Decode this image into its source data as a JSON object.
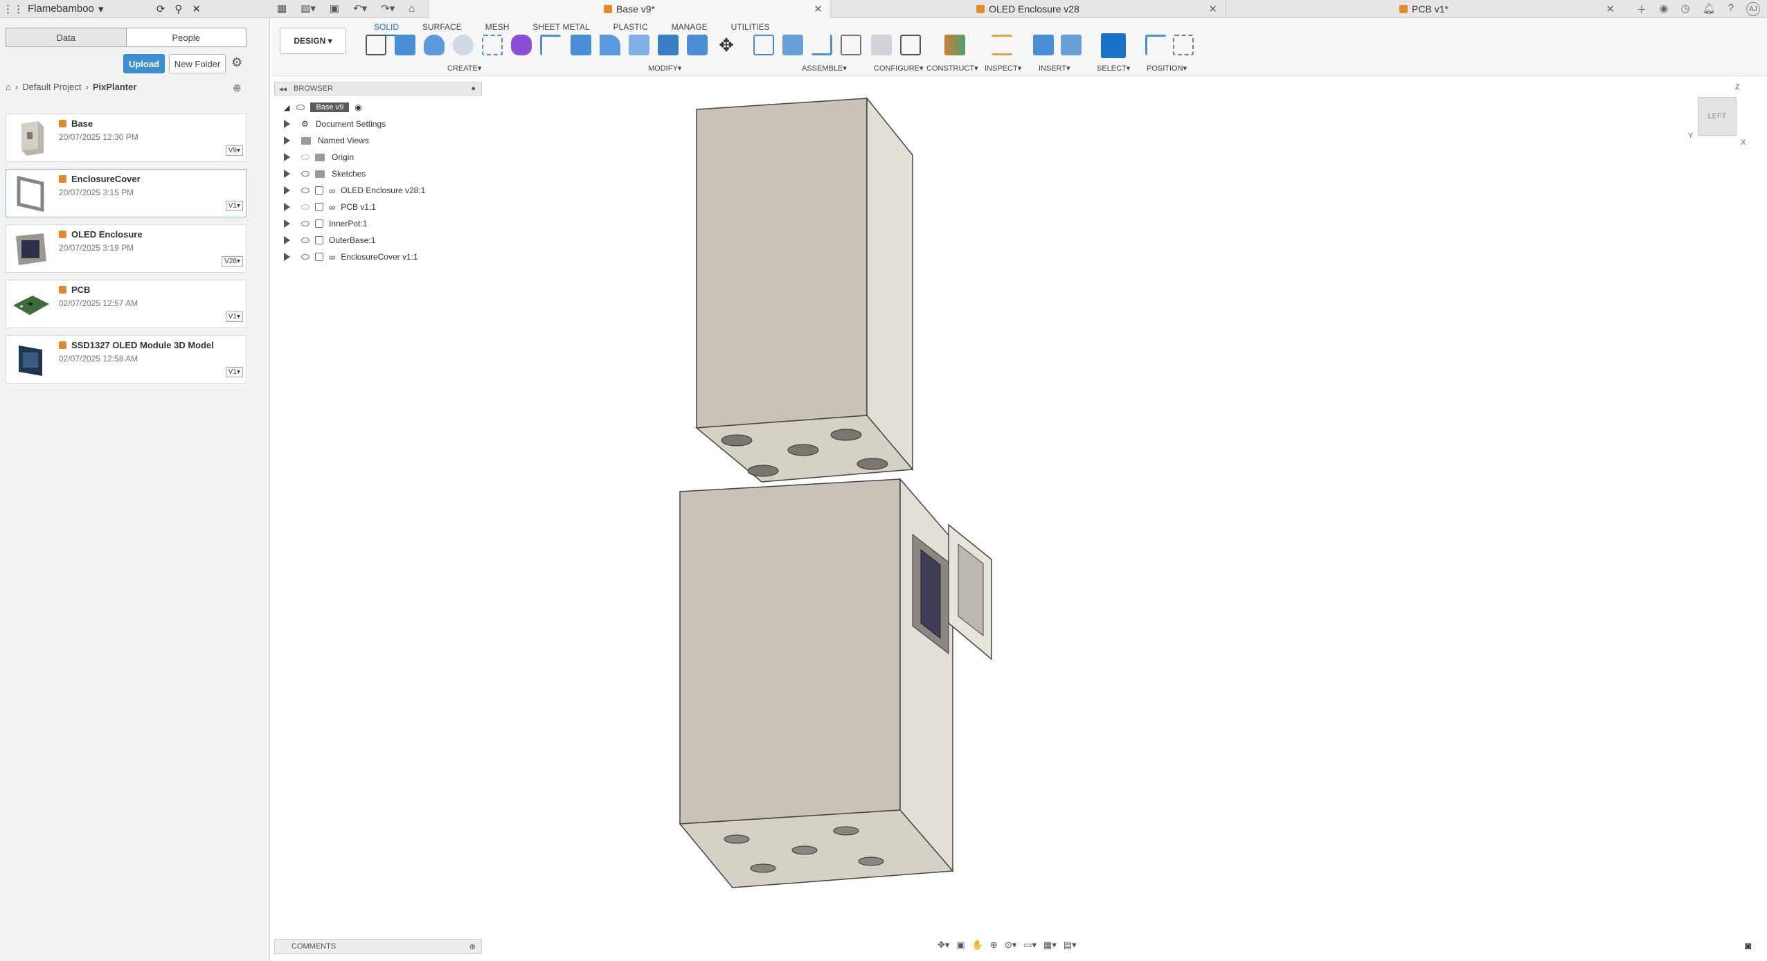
{
  "top_bar": {
    "team_name": "Flamebamboo",
    "tabs": [
      {
        "label": "Base v9*"
      },
      {
        "label": "OLED Enclosure v28"
      },
      {
        "label": "PCB v1*"
      }
    ],
    "user_initials": "AJ"
  },
  "data_panel": {
    "tab_data": "Data",
    "tab_people": "People",
    "upload_label": "Upload",
    "new_folder_label": "New Folder",
    "breadcrumb": [
      "Default Project",
      "PixPlanter"
    ],
    "files": [
      {
        "name": "Base",
        "date": "20/07/2025 12:30 PM",
        "version": "V9"
      },
      {
        "name": "EnclosureCover",
        "date": "20/07/2025 3:15 PM",
        "version": "V1"
      },
      {
        "name": "OLED Enclosure",
        "date": "20/07/2025 3:19 PM",
        "version": "V28"
      },
      {
        "name": "PCB",
        "date": "02/07/2025 12:57 AM",
        "version": "V1"
      },
      {
        "name": "SSD1327 OLED Module 3D Model",
        "date": "02/07/2025 12:58 AM",
        "version": "V1"
      }
    ]
  },
  "toolbar": {
    "workspace_label": "DESIGN",
    "workspace_tabs": [
      "SOLID",
      "SURFACE",
      "MESH",
      "SHEET METAL",
      "PLASTIC",
      "MANAGE",
      "UTILITIES"
    ],
    "groups": [
      "CREATE",
      "MODIFY",
      "ASSEMBLE",
      "CONFIGURE",
      "CONSTRUCT",
      "INSPECT",
      "INSERT",
      "SELECT",
      "POSITION"
    ]
  },
  "browser": {
    "title": "BROWSER",
    "root": "Base v9",
    "items": [
      {
        "label": "Document Settings",
        "kind": "gear"
      },
      {
        "label": "Named Views",
        "kind": "folder"
      },
      {
        "label": "Origin",
        "kind": "folder"
      },
      {
        "label": "Sketches",
        "kind": "folder"
      },
      {
        "label": "OLED Enclosure v28:1",
        "kind": "link"
      },
      {
        "label": "PCB v1:1",
        "kind": "link"
      },
      {
        "label": "InnerPot:1",
        "kind": "component"
      },
      {
        "label": "OuterBase:1",
        "kind": "component"
      },
      {
        "label": "EnclosureCover v1:1",
        "kind": "link"
      }
    ]
  },
  "comments_label": "COMMENTS",
  "view_cube_label": "LEFT",
  "axes": {
    "z": "Z",
    "y": "Y",
    "x": "X"
  }
}
